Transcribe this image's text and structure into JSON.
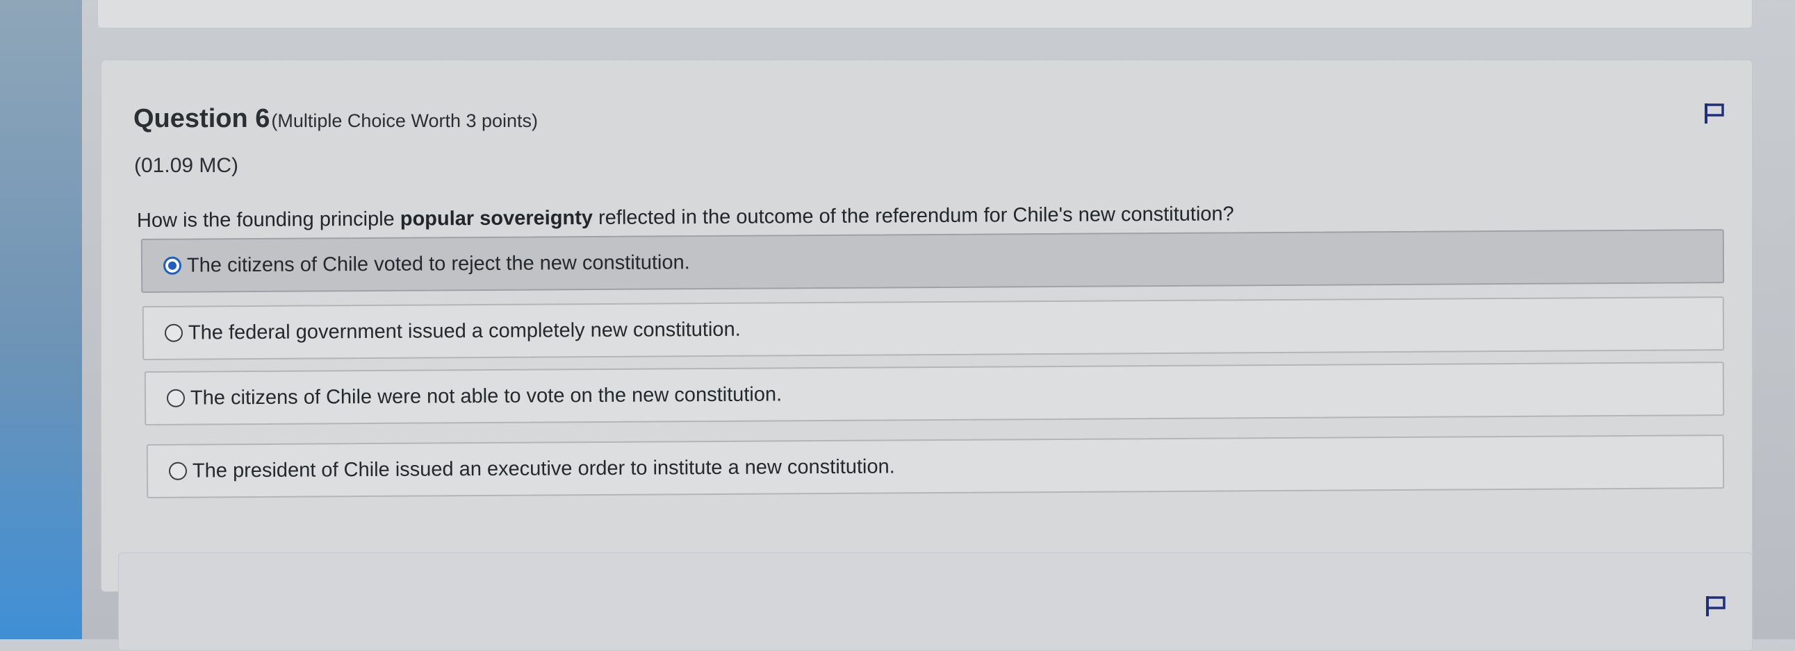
{
  "question": {
    "title": "Question 6",
    "meta": "(Multiple Choice Worth 3 points)",
    "code": "(01.09 MC)",
    "prompt_before": "How is the founding principle ",
    "prompt_bold": "popular sovereignty",
    "prompt_after": " reflected in the outcome of the referendum for Chile's new constitution?",
    "options": [
      {
        "label": "The citizens of Chile voted to reject the new constitution.",
        "selected": true
      },
      {
        "label": "The federal government issued a completely new constitution.",
        "selected": false
      },
      {
        "label": "The citizens of Chile were not able to vote on the new constitution.",
        "selected": false
      },
      {
        "label": "The president of Chile issued an executive order to institute a new constitution.",
        "selected": false
      }
    ]
  },
  "icons": {
    "flag": "flag-icon"
  },
  "colors": {
    "accent": "#1f5fbf",
    "selected_row": "#c0c2c5"
  }
}
